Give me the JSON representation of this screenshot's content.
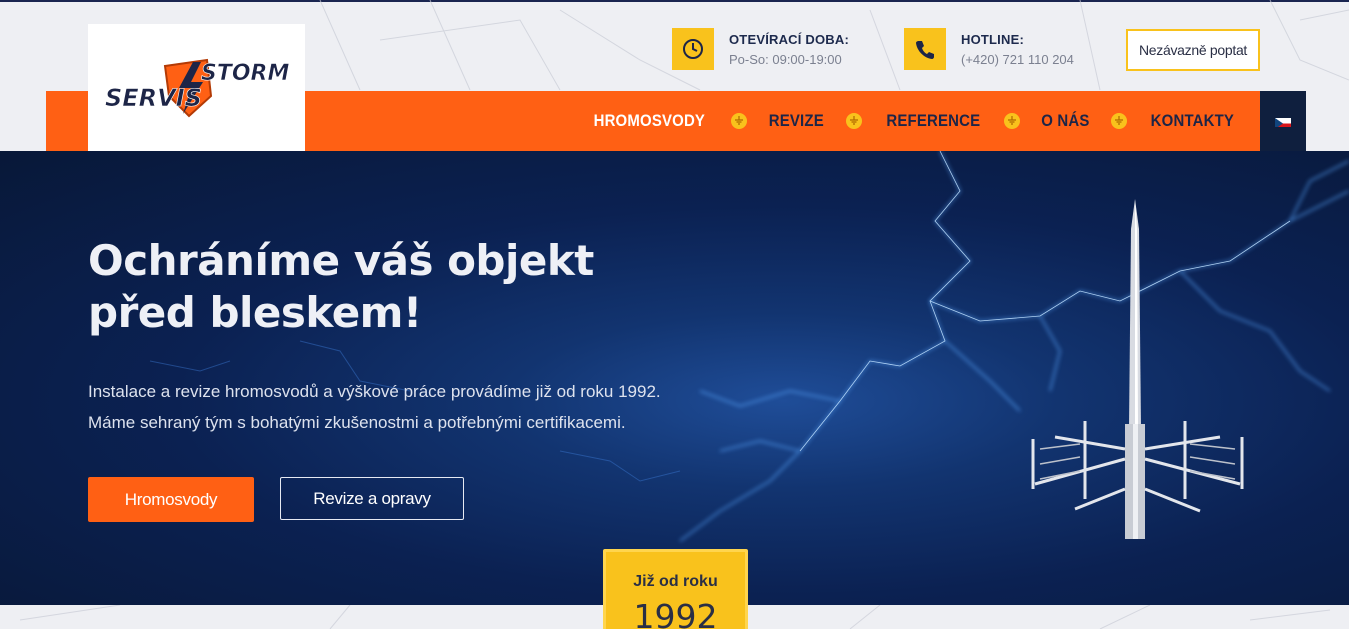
{
  "logo": {
    "word1": "STORM",
    "word2": "SERVIS"
  },
  "header": {
    "hours_label": "OTEVÍRACÍ DOBA:",
    "hours_value": "Po-So: 09:00-19:00",
    "hotline_label": "HOTLINE:",
    "hotline_value": "(+420) 721 110 204",
    "quote_button": "Nezávazně poptat"
  },
  "nav": {
    "items": [
      "HROMOSVODY",
      "REVIZE",
      "REFERENCE",
      "O NÁS",
      "KONTAKTY"
    ],
    "language_icon": "czech-flag-icon"
  },
  "hero": {
    "title_line1": "Ochráníme váš objekt",
    "title_line2": "před bleskem!",
    "desc_line1": "Instalace a revize hromosvodů a výškové práce provádíme již od roku 1992.",
    "desc_line2": "Máme sehraný tým s bohatými zkušenostmi a potřebnými certifikacemi.",
    "primary_button": "Hromosvody",
    "secondary_button": "Revize a opravy"
  },
  "badge": {
    "label": "Již od roku",
    "year": "1992"
  },
  "colors": {
    "accent": "#ff6014",
    "yellow": "#f9c21c",
    "navy": "#0b2152"
  }
}
